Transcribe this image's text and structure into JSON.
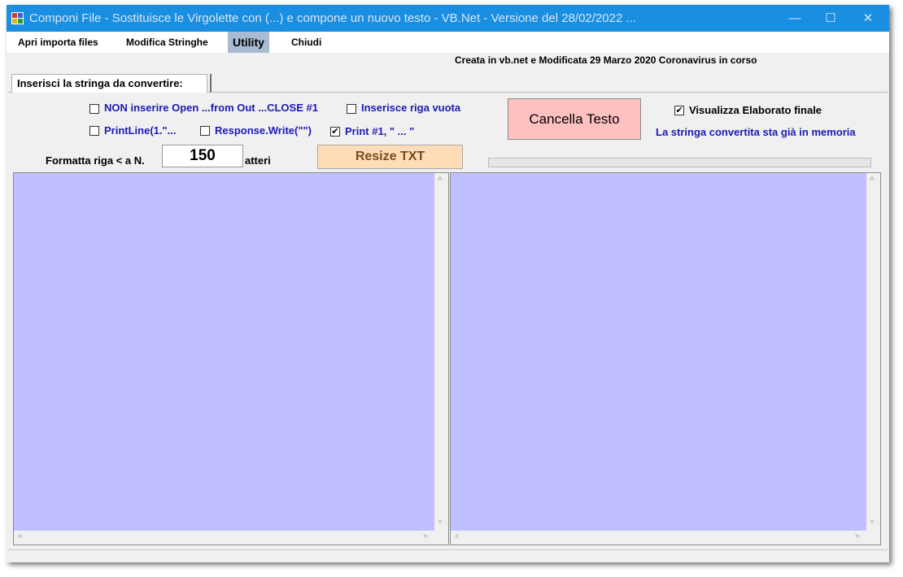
{
  "window": {
    "title": "Componi File - Sostituisce le Virgolette con (...) e compone un nuovo testo   - VB.Net  - Versione del 28/02/2022 ...",
    "minimize_glyph": "—",
    "maximize_glyph": "☐",
    "close_glyph": "✕"
  },
  "menu": {
    "items": [
      "Apri importa files",
      "Modifica Stringhe",
      "Utility",
      "Chiudi"
    ]
  },
  "info": {
    "created_note": "Creata in vb.net e Modificata 29 Marzo 2020 Coronavirus in corso"
  },
  "tab": {
    "label": "Inserisci la stringa da convertire:"
  },
  "options": {
    "non_inserire_open": {
      "label": "NON inserire Open ...from Out ...CLOSE #1",
      "checked": false
    },
    "inserisce_riga_vuota": {
      "label": "Inserisce riga vuota",
      "checked": false
    },
    "printline": {
      "label": "PrintLine(1.\"...",
      "checked": false
    },
    "response_write": {
      "label": "Response.Write(\"\")",
      "checked": false
    },
    "print1": {
      "label": "Print #1, \" ... \"",
      "checked": true
    },
    "visualizza": {
      "label": "Visualizza Elaborato finale",
      "checked": true
    }
  },
  "buttons": {
    "cancella": "Cancella Testo",
    "resize": "Resize TXT"
  },
  "labels": {
    "memoria": "La stringa convertita sta già in memoria",
    "formatta": "Formatta riga < a N.",
    "atteri": "atteri"
  },
  "inputs": {
    "numero_caratteri": "150"
  },
  "progress": {
    "value": 0
  },
  "glyphs": {
    "up": "˄",
    "down": "˅",
    "left": "<",
    "right": ">",
    "check": "✔"
  },
  "colors": {
    "titlebar": "#1a8ee0",
    "textarea_bg": "#c0c0ff",
    "cancella_bg": "#ffc0c0",
    "resize_bg": "#ffdcb8",
    "option_text": "#1a1ab4"
  }
}
